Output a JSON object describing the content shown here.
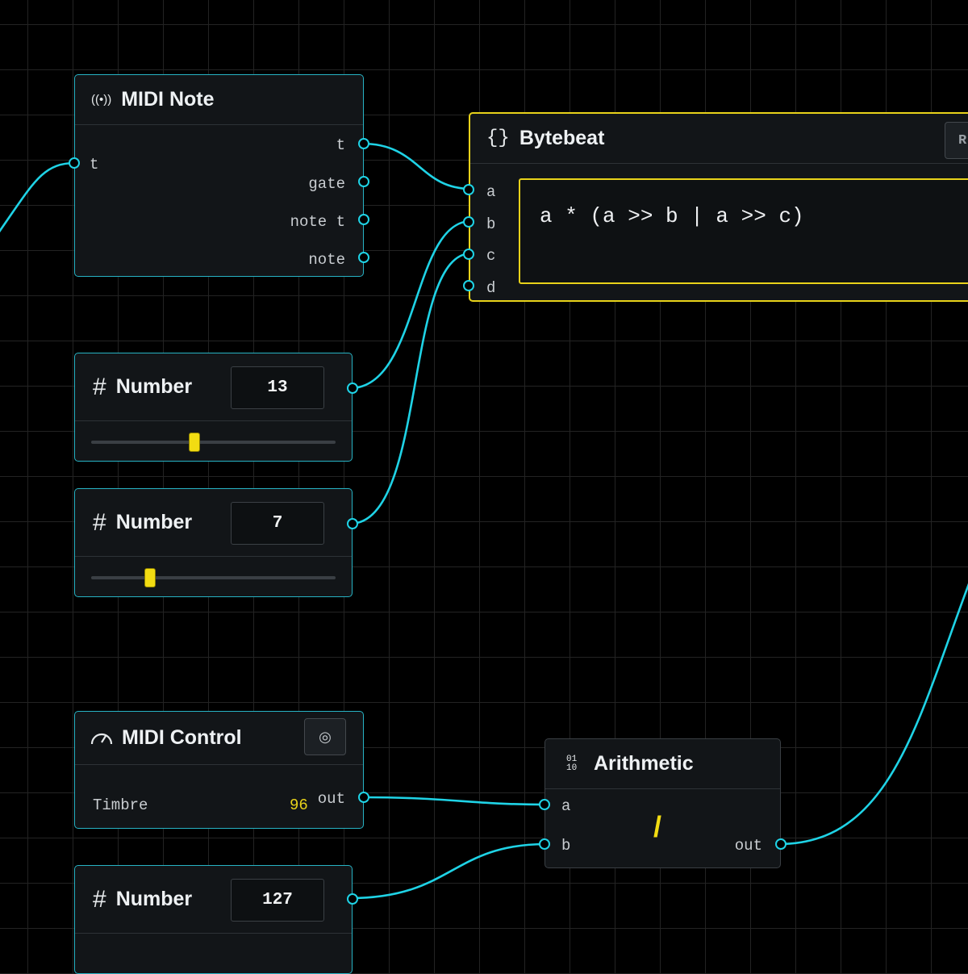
{
  "nodes": {
    "midi_note": {
      "title": "MIDI Note",
      "icon": "broadcast-icon",
      "inputs": [
        "t"
      ],
      "outputs": [
        "t",
        "gate",
        "note t",
        "note"
      ]
    },
    "bytebeat": {
      "title": "Bytebeat",
      "icon": "braces-icon",
      "inputs": [
        "a",
        "b",
        "c",
        "d"
      ],
      "expression": "a * (a >> b | a >> c)",
      "button_label": "R"
    },
    "number_1": {
      "title": "Number",
      "icon": "hash-icon",
      "value": "13",
      "slider_fraction": 0.42
    },
    "number_2": {
      "title": "Number",
      "icon": "hash-icon",
      "value": "7",
      "slider_fraction": 0.23
    },
    "number_3": {
      "title": "Number",
      "icon": "hash-icon",
      "value": "127"
    },
    "midi_control": {
      "title": "MIDI Control",
      "icon": "gauge-icon",
      "label": "Timbre",
      "value": "96",
      "output": "out"
    },
    "arithmetic": {
      "title": "Arithmetic",
      "icon": "binary-icon",
      "inputs": [
        "a",
        "b"
      ],
      "operator": "/",
      "output": "out"
    }
  },
  "colors": {
    "background": "#000000",
    "grid": "#232323",
    "wire": "#1fd3e6",
    "node_border": "#27b3c4",
    "selected_border": "#e8d21a",
    "slider_thumb": "#f2dc12",
    "value_highlight": "#e8d21a"
  }
}
